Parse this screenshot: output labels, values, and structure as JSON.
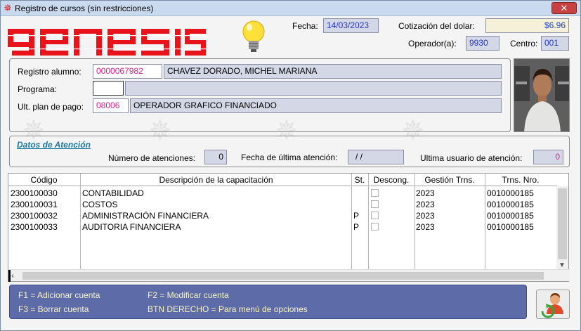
{
  "window": {
    "title": "Registro de cursos (sin restricciones)",
    "close_label": "✕"
  },
  "logo": {
    "text": "genesis",
    "color": "#e8131b"
  },
  "header": {
    "fecha_label": "Fecha:",
    "fecha_value": "14/03/2023",
    "cotizacion_label": "Cotización del dolar:",
    "cotizacion_value": "$6.96",
    "operador_label": "Operador(a):",
    "operador_value": "9930",
    "centro_label": "Centro:",
    "centro_value": "001"
  },
  "student": {
    "registro_label": "Registro alumno:",
    "registro_code": "0000067982",
    "registro_name": "CHAVEZ DORADO, MICHEL MARIANA",
    "programa_label": "Programa:",
    "programa_code": "",
    "programa_name": "",
    "plan_label": "Ult. plan de pago:",
    "plan_code": "08006",
    "plan_name": "OPERADOR GRAFICO FINANCIADO"
  },
  "atencion": {
    "section_title": "Datos de Atención",
    "numero_label": "Número de atenciones:",
    "numero_value": "0",
    "fecha_label": "Fecha de última atención:",
    "fecha_value": "/ /",
    "usuario_label": "Ultima usuario de atención:",
    "usuario_value": "0"
  },
  "table": {
    "columns": [
      "Código",
      "Descripción de la capacitación",
      "St.",
      "Descong.",
      "Gestión Trns.",
      "Trns. Nro."
    ],
    "rows": [
      {
        "codigo": "2300100030",
        "descripcion": "CONTABILIDAD",
        "st": "",
        "gestion": "2023",
        "nro": "0010000185"
      },
      {
        "codigo": "2300100031",
        "descripcion": "COSTOS",
        "st": "",
        "gestion": "2023",
        "nro": "0010000185"
      },
      {
        "codigo": "2300100032",
        "descripcion": "ADMINISTRACIÓN FINANCIERA",
        "st": "P",
        "gestion": "2023",
        "nro": "0010000185"
      },
      {
        "codigo": "2300100033",
        "descripcion": "AUDITORIA FINANCIERA",
        "st": "P",
        "gestion": "2023",
        "nro": "0010000185"
      }
    ]
  },
  "hints": {
    "f1": "F1 = Adicionar cuenta",
    "f2": "F2 = Modificar cuenta",
    "f3": "F3 = Borrar cuenta",
    "btn": "BTN DERECHO = Para menú de opciones"
  }
}
